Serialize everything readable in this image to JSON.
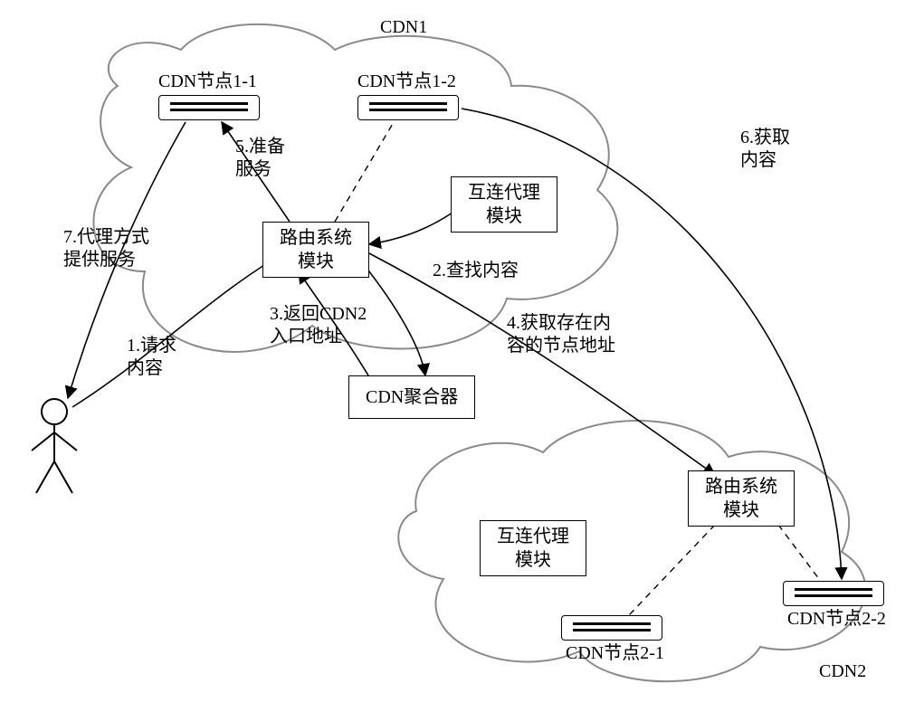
{
  "cdn1": {
    "title": "CDN1",
    "node11": "CDN节点1-1",
    "node12": "CDN节点1-2",
    "routing": "路由系统\n模块",
    "proxy": "互连代理\n模块"
  },
  "cdn2": {
    "title": "CDN2",
    "node21": "CDN节点2-1",
    "node22": "CDN节点2-2",
    "routing": "路由系统\n模块",
    "proxy": "互连代理\n模块"
  },
  "aggregator": "CDN聚合器",
  "steps": {
    "s1": "1.请求\n内容",
    "s2": "2.查找内容",
    "s3": "3.返回CDN2\n入口地址",
    "s4": "4.获取存在内\n容的节点地址",
    "s5": "5.准备\n服务",
    "s6": "6.获取\n内容",
    "s7": "7.代理方式\n提供服务"
  }
}
